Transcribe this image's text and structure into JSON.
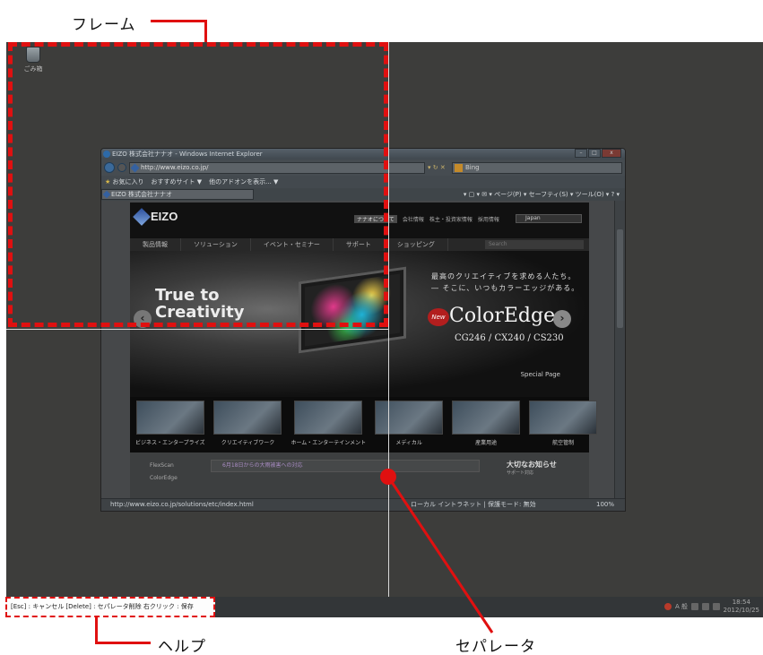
{
  "callouts": {
    "frame": "フレーム",
    "help": "ヘルプ",
    "separator": "セパレータ"
  },
  "desktop": {
    "recycle_bin": "ごみ箱"
  },
  "browser": {
    "title": "EIZO 株式会社ナナオ - Windows Internet Explorer",
    "window_buttons": [
      "–",
      "□",
      "x"
    ],
    "address": "http://www.eizo.co.jp/",
    "search_placeholder": "Bing",
    "favorites": "お気に入り",
    "recommended": "おすすめサイト ▼",
    "addons": "他のアドオンを表示... ▼",
    "tab_title": "EIZO 株式会社ナナオ",
    "command_bar": "▾ ▢ ▾ ✉ ▾ ページ(P) ▾  セーフティ(S) ▾  ツール(O) ▾  ? ▾",
    "status_url": "http://www.eizo.co.jp/solutions/etc/index.html",
    "status_zone": "ローカル イントラネット | 保護モード: 無効",
    "status_zoom": "100%"
  },
  "site": {
    "logo": "EIZO",
    "toplinks": [
      "ナナオについて",
      "会社情報",
      "株主・投資家情報",
      "採用情報"
    ],
    "language": "Japan",
    "nav": [
      "製品情報",
      "ソリューション",
      "イベント・セミナー",
      "サポート",
      "ショッピング"
    ],
    "search_placeholder": "Search",
    "hero": {
      "tagline_1": "True to",
      "tagline_2": "Creativity",
      "copy_1": "最高のクリエイティブを求める人たち。",
      "copy_2": "― そこに、いつもカラーエッジがある。",
      "badge": "New",
      "brand": "ColorEdge",
      "models": "CG246 / CX240 / CS230",
      "special": "Special Page"
    },
    "thumbs": [
      "ビジネス・エンタープライズ",
      "クリエイティブワーク",
      "ホーム・エンターテインメント",
      "メディカル",
      "産業用途",
      "航空管制"
    ],
    "side_links": [
      "FlexScan",
      "ColorEdge"
    ],
    "news": "6月18日からの大雨被害への対応",
    "notice_title": "大切なお知らせ",
    "notice_sub": "サポート対応"
  },
  "help": {
    "text": "[Esc] : キャンセル  [Delete] : セパレータ削除  右クリック : 保存"
  },
  "taskbar": {
    "ime": "A 般",
    "clock_time": "18:54",
    "clock_date": "2012/10/25"
  },
  "colors": {
    "annotation_red": "#e01010",
    "desktop_dim": "#3d3d3b"
  }
}
